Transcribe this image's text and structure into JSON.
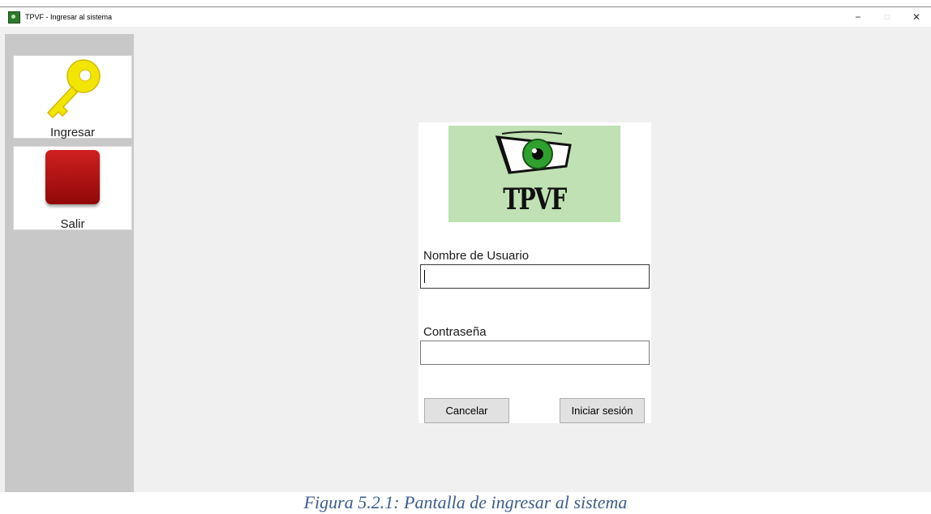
{
  "window": {
    "title": "TPVF - Ingresar al sistema",
    "controls": {
      "minimize": "−",
      "maximize": "□",
      "close": "✕"
    }
  },
  "sidebar": {
    "items": [
      {
        "label": "Ingresar",
        "icon": "key-icon",
        "color": "#f2e600"
      },
      {
        "label": "Salir",
        "icon": "stop-square-icon",
        "color": "#b01010"
      }
    ]
  },
  "login": {
    "logo_text": "TPVF",
    "username_label": "Nombre de Usuario",
    "username_value": "",
    "password_label": "Contraseña",
    "password_value": "",
    "cancel_label": "Cancelar",
    "submit_label": "Iniciar sesión"
  },
  "caption": "Figura 5.2.1: Pantalla de ingresar al sistema",
  "colors": {
    "sidebar_bg": "#c8c8c8",
    "window_bg": "#f0f0f0",
    "logo_bg": "#bfe1b3",
    "iris": "#2fa02f"
  }
}
